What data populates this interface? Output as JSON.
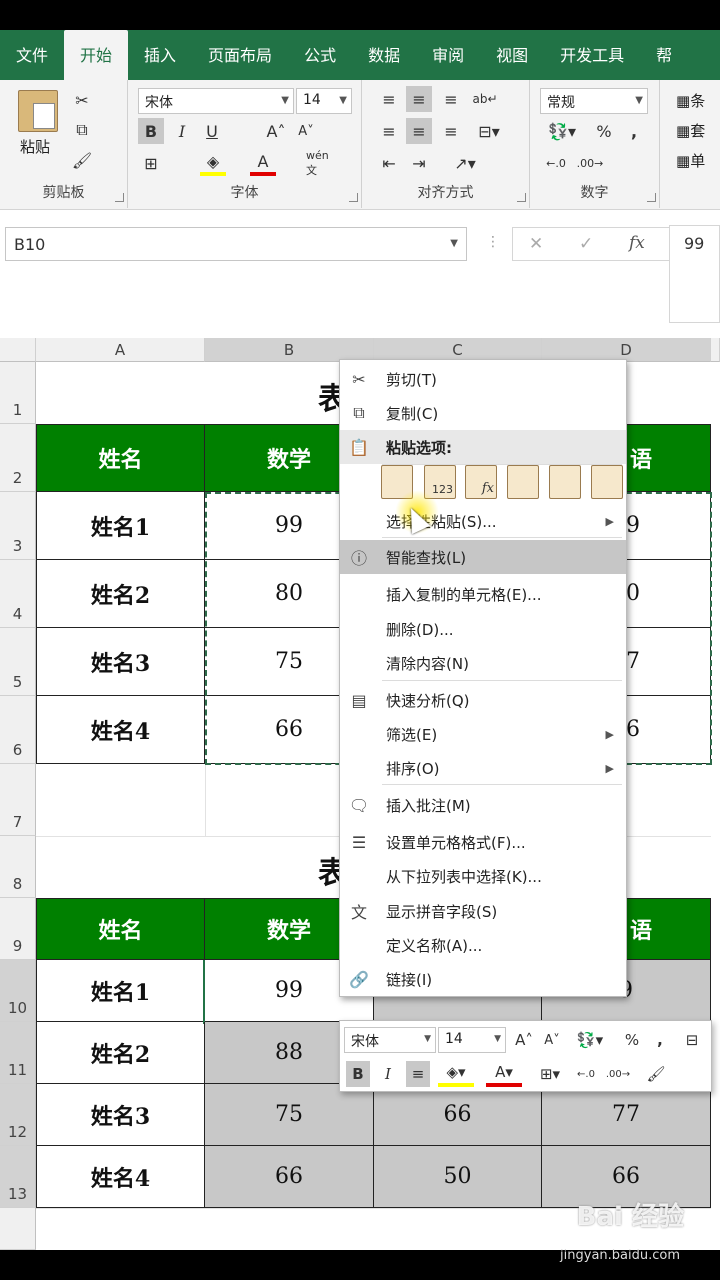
{
  "tabs": [
    "文件",
    "开始",
    "插入",
    "页面布局",
    "公式",
    "数据",
    "审阅",
    "视图",
    "开发工具",
    "帮"
  ],
  "active_tab": "开始",
  "ribbon": {
    "paste_label": "粘贴",
    "groups": {
      "clipboard": "剪贴板",
      "font": "字体",
      "align": "对齐方式",
      "number": "数字"
    },
    "font_name": "宋体",
    "font_size": "14",
    "bold": "B",
    "italic": "I",
    "underline": "U",
    "number_format": "常规",
    "percent": "%",
    "comma": ",",
    "right_items": [
      "条",
      "套",
      "单"
    ]
  },
  "formula_bar": {
    "name_box": "B10",
    "fx": "fx",
    "value": "99"
  },
  "columns": [
    "A",
    "B",
    "C",
    "D"
  ],
  "rows": [
    "1",
    "2",
    "3",
    "4",
    "5",
    "6",
    "7",
    "8",
    "9",
    "10",
    "11",
    "12",
    "13"
  ],
  "title_fragment": "表",
  "table1": {
    "headers": [
      "姓名",
      "数学",
      "语"
    ],
    "rows": [
      [
        "姓名1",
        "99",
        "9"
      ],
      [
        "姓名2",
        "80",
        "0"
      ],
      [
        "姓名3",
        "75",
        "7"
      ],
      [
        "姓名4",
        "66",
        "6"
      ]
    ]
  },
  "table2": {
    "headers": [
      "姓名",
      "数学",
      "语"
    ],
    "rows": [
      [
        "姓名1",
        "99",
        "",
        "9"
      ],
      [
        "姓名2",
        "88",
        "",
        ""
      ],
      [
        "姓名3",
        "75",
        "66",
        "77"
      ],
      [
        "姓名4",
        "66",
        "50",
        "66"
      ]
    ]
  },
  "context_menu": {
    "items": [
      {
        "label": "剪切(T)",
        "icon": "scissors-icon"
      },
      {
        "label": "复制(C)",
        "icon": "copy-icon"
      },
      {
        "label": "粘贴选项:",
        "icon": "clipboard-icon"
      },
      {
        "label": "选择性粘贴(S)...",
        "icon": ""
      },
      {
        "label": "智能查找(L)",
        "icon": "info-icon"
      },
      {
        "label": "插入复制的单元格(E)...",
        "icon": ""
      },
      {
        "label": "删除(D)...",
        "icon": ""
      },
      {
        "label": "清除内容(N)",
        "icon": ""
      },
      {
        "label": "快速分析(Q)",
        "icon": "quick-analysis-icon"
      },
      {
        "label": "筛选(E)",
        "icon": ""
      },
      {
        "label": "排序(O)",
        "icon": ""
      },
      {
        "label": "插入批注(M)",
        "icon": "comment-icon"
      },
      {
        "label": "设置单元格格式(F)...",
        "icon": "format-cells-icon"
      },
      {
        "label": "从下拉列表中选择(K)...",
        "icon": ""
      },
      {
        "label": "显示拼音字段(S)",
        "icon": "phonetic-icon"
      },
      {
        "label": "定义名称(A)...",
        "icon": ""
      },
      {
        "label": "链接(I)",
        "icon": "link-icon"
      }
    ],
    "paste_option_sublabels": [
      "",
      "123",
      "fx",
      "",
      "",
      ""
    ]
  },
  "mini_toolbar": {
    "font_name": "宋体",
    "font_size": "14",
    "bold": "B",
    "italic": "I",
    "percent": "%",
    "comma": ","
  },
  "watermark": {
    "logo": "Bai 经验",
    "url": "jingyan.baidu.com"
  },
  "colors": {
    "excel_green": "#217346",
    "header_green": "#008000",
    "selection_gray": "#c8c8c8"
  }
}
